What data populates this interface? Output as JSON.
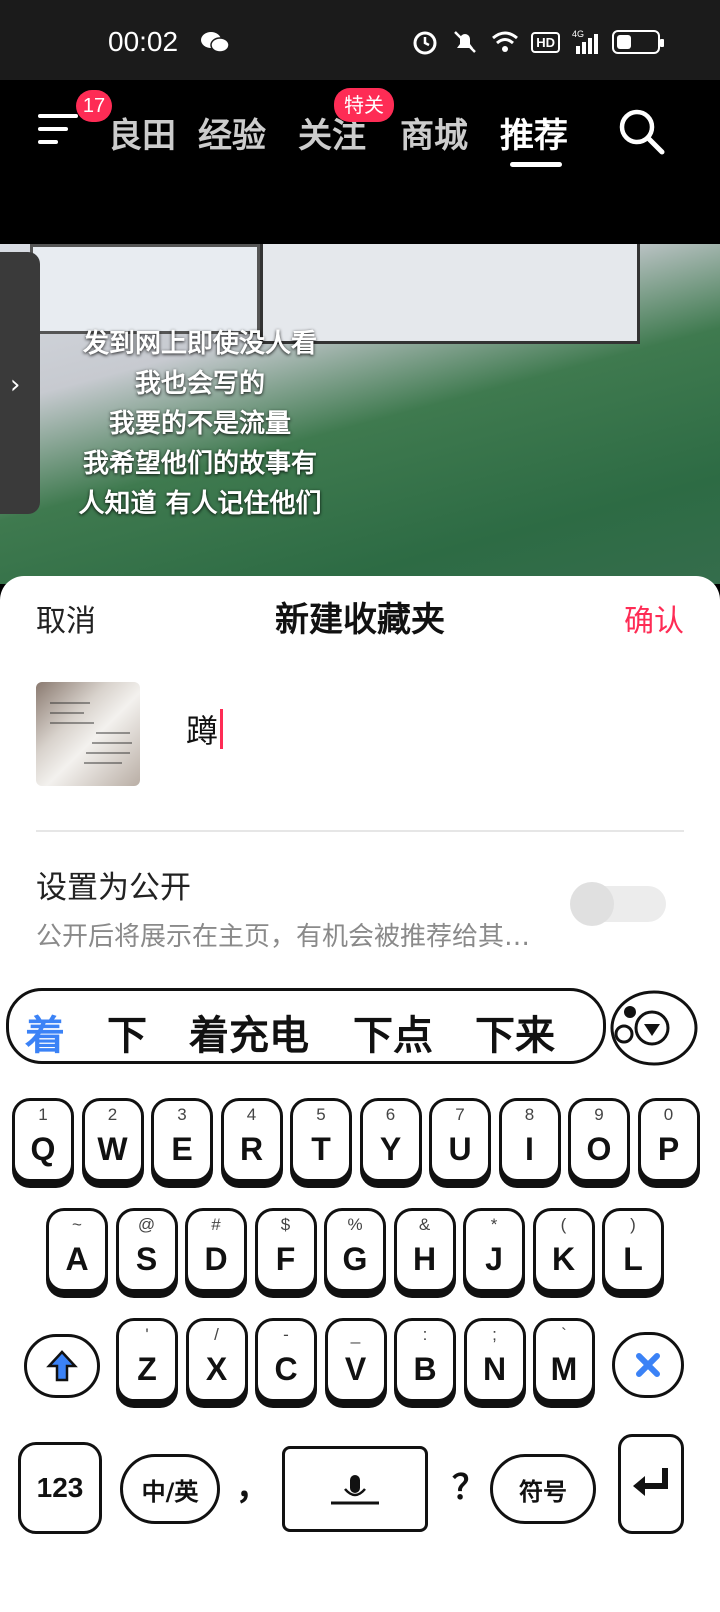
{
  "status_bar": {
    "time": "00:02",
    "network": "4G",
    "hd_badge": "HD",
    "battery_level": 0.35
  },
  "top_nav": {
    "menu_badge": "17",
    "tabs": [
      {
        "label": "良田",
        "active": false
      },
      {
        "label": "经验",
        "active": false
      },
      {
        "label": "关注",
        "active": false,
        "badge": "特关"
      },
      {
        "label": "商城",
        "active": false
      },
      {
        "label": "推荐",
        "active": true
      }
    ]
  },
  "video": {
    "caption_lines": [
      "发到网上即使没人看",
      "我也会写的",
      "我要的不是流量",
      "我希望他们的故事有",
      "人知道  有人记住他们"
    ]
  },
  "sheet": {
    "cancel_label": "取消",
    "title": "新建收藏夹",
    "confirm_label": "确认",
    "name_value": "蹲",
    "public_label": "设置为公开",
    "public_desc": "公开后将展示在主页，有机会被推荐给其…",
    "public_enabled": false
  },
  "keyboard": {
    "candidates": [
      "着",
      "下",
      "着充电",
      "下点",
      "下来"
    ],
    "row1": [
      {
        "sub": "1",
        "main": "Q"
      },
      {
        "sub": "2",
        "main": "W"
      },
      {
        "sub": "3",
        "main": "E"
      },
      {
        "sub": "4",
        "main": "R"
      },
      {
        "sub": "5",
        "main": "T"
      },
      {
        "sub": "6",
        "main": "Y"
      },
      {
        "sub": "7",
        "main": "U"
      },
      {
        "sub": "8",
        "main": "I"
      },
      {
        "sub": "9",
        "main": "O"
      },
      {
        "sub": "0",
        "main": "P"
      }
    ],
    "row2": [
      {
        "sub": "~",
        "main": "A"
      },
      {
        "sub": "@",
        "main": "S"
      },
      {
        "sub": "#",
        "main": "D"
      },
      {
        "sub": "$",
        "main": "F"
      },
      {
        "sub": "%",
        "main": "G"
      },
      {
        "sub": "&",
        "main": "H"
      },
      {
        "sub": "*",
        "main": "J"
      },
      {
        "sub": "(",
        "main": "K"
      },
      {
        "sub": ")",
        "main": "L"
      }
    ],
    "row3": [
      {
        "sub": "'",
        "main": "Z"
      },
      {
        "sub": "/",
        "main": "X"
      },
      {
        "sub": "-",
        "main": "C"
      },
      {
        "sub": "_",
        "main": "V"
      },
      {
        "sub": ":",
        "main": "B"
      },
      {
        "sub": ";",
        "main": "N"
      },
      {
        "sub": "`",
        "main": "M"
      }
    ],
    "num_label": "123",
    "lang_label": "中/英",
    "comma": "，",
    "period": "？",
    "symbol_label": "符号"
  }
}
